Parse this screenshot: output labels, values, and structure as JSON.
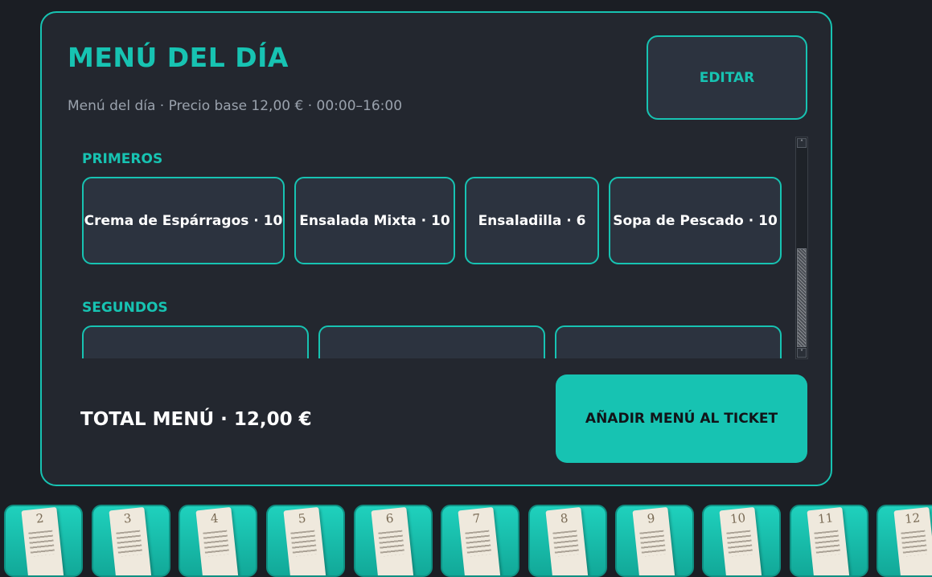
{
  "header": {
    "title": "MENÚ DEL DÍA",
    "subtitle": "Menú del día · Precio base 12,00 € · 00:00–16:00",
    "edit_label": "EDITAR"
  },
  "sections": {
    "primeros": {
      "label": "PRIMEROS",
      "items": [
        {
          "label": "Crema de Espárragos · 10"
        },
        {
          "label": "Ensalada Mixta · 10"
        },
        {
          "label": "Ensaladilla · 6"
        },
        {
          "label": "Sopa de Pescado · 10"
        }
      ]
    },
    "segundos": {
      "label": "SEGUNDOS",
      "items": [
        {
          "label": ""
        },
        {
          "label": ""
        },
        {
          "label": ""
        }
      ]
    }
  },
  "footer": {
    "total_label": "TOTAL MENÚ · 12,00 €",
    "add_label": "AÑADIR MENÚ AL TICKET"
  },
  "tickets": [
    "2",
    "3",
    "4",
    "5",
    "6",
    "7",
    "8",
    "9",
    "10",
    "11",
    "12"
  ],
  "colors": {
    "accent": "#17c3b2",
    "background": "#1b1e24",
    "panel": "#23272f",
    "card": "#2c333f"
  }
}
